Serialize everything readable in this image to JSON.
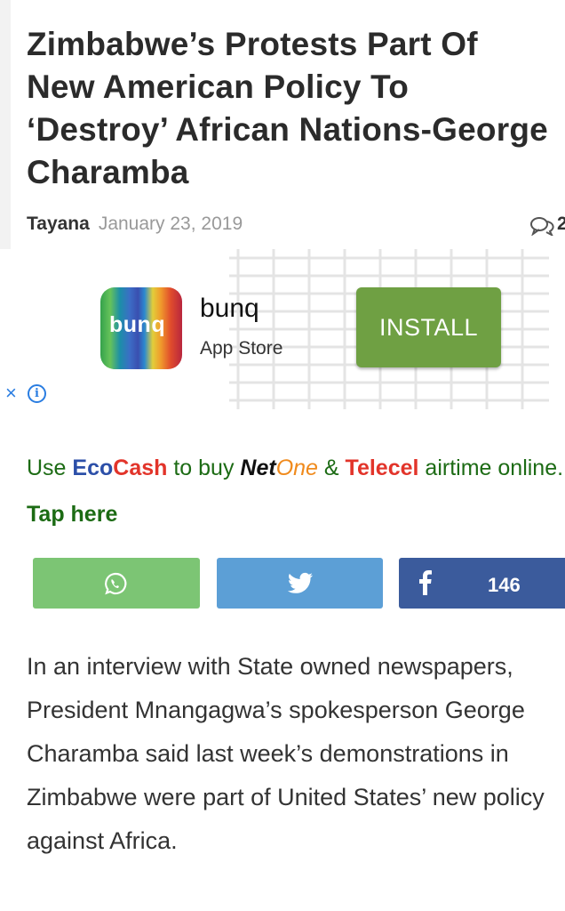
{
  "article": {
    "title": "Zimbabwe’s Protests Part Of New American Policy To ‘Destroy’ African Nations-George Charamba",
    "author": "Tayana",
    "date": "January 23, 2019",
    "comments_count": "2",
    "body": "In an interview with State owned newspapers, President Mnangagwa’s spokesperson George Charamba said last week’s demonstrations in Zimbabwe were part of United States’ new policy against Africa."
  },
  "ad": {
    "icon_text": "bunq",
    "app_name": "bunq",
    "store": "App Store",
    "install_label": "INSTALL",
    "close_symbol": "×",
    "info_symbol": "i"
  },
  "promo": {
    "part1": "Use ",
    "eco1": "Eco",
    "eco2": "Cash",
    "part2": " to buy ",
    "net1": "Net",
    "net2": "One",
    "part3": " & ",
    "telecel": "Telecel",
    "part4": " airtime online. ",
    "tap": "Tap here"
  },
  "share": {
    "facebook_count": "146",
    "icons": [
      "whatsapp-icon",
      "twitter-icon",
      "facebook-icon"
    ]
  },
  "colors": {
    "title": "#2b2b2b",
    "install": "#6fa043",
    "whatsapp": "#7cc574",
    "twitter": "#5c9fd6",
    "facebook": "#3b5b9c",
    "promo_green": "#1c6b14"
  }
}
